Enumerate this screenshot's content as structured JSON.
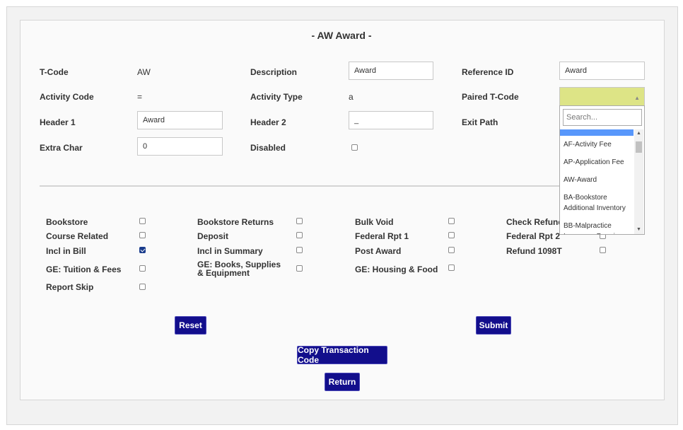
{
  "page": {
    "title": "- AW  Award -"
  },
  "fields": {
    "tcode_label": "T-Code",
    "tcode_value": "AW",
    "description_label": "Description",
    "description_value": "Award",
    "reference_label": "Reference ID",
    "reference_value": "Award",
    "activity_code_label": "Activity Code",
    "activity_code_value": "=",
    "activity_type_label": "Activity Type",
    "activity_type_value": "a",
    "paired_label": "Paired T-Code",
    "header1_label": "Header 1",
    "header1_value": "Award",
    "header2_label": "Header 2",
    "header2_value": "_",
    "exit_path_label": "Exit Path",
    "extra_char_label": "Extra Char",
    "extra_char_value": "0",
    "disabled_label": "Disabled"
  },
  "dropdown": {
    "search_placeholder": "Search...",
    "options": [
      "AF-Activity Fee",
      "AP-Application Fee",
      "AW-Award",
      "BA-Bookstore Additional Inventory",
      "BB-Malpractice Insurance Premium"
    ]
  },
  "flags": {
    "bookstore": "Bookstore",
    "bookstore_returns": "Bookstore Returns",
    "bulk_void": "Bulk Void",
    "check_refund": "Check Refund",
    "course_related": "Course Related",
    "deposit": "Deposit",
    "federal_rpt1": "Federal Rpt 1",
    "federal_rpt2": "Federal Rpt 2",
    "incl_in_bill": "Incl in Bill",
    "incl_in_summary": "Incl in Summary",
    "post_award": "Post Award",
    "refund_1098t": "Refund 1098T",
    "ge_tuition": "GE: Tuition & Fees",
    "ge_books": "GE: Books, Supplies & Equipment",
    "ge_housing": "GE: Housing & Food",
    "report_skip": "Report Skip",
    "incl_in_bill_checked": true
  },
  "buttons": {
    "reset": "Reset",
    "submit": "Submit",
    "copy": "Copy Transaction Code",
    "return": "Return"
  }
}
